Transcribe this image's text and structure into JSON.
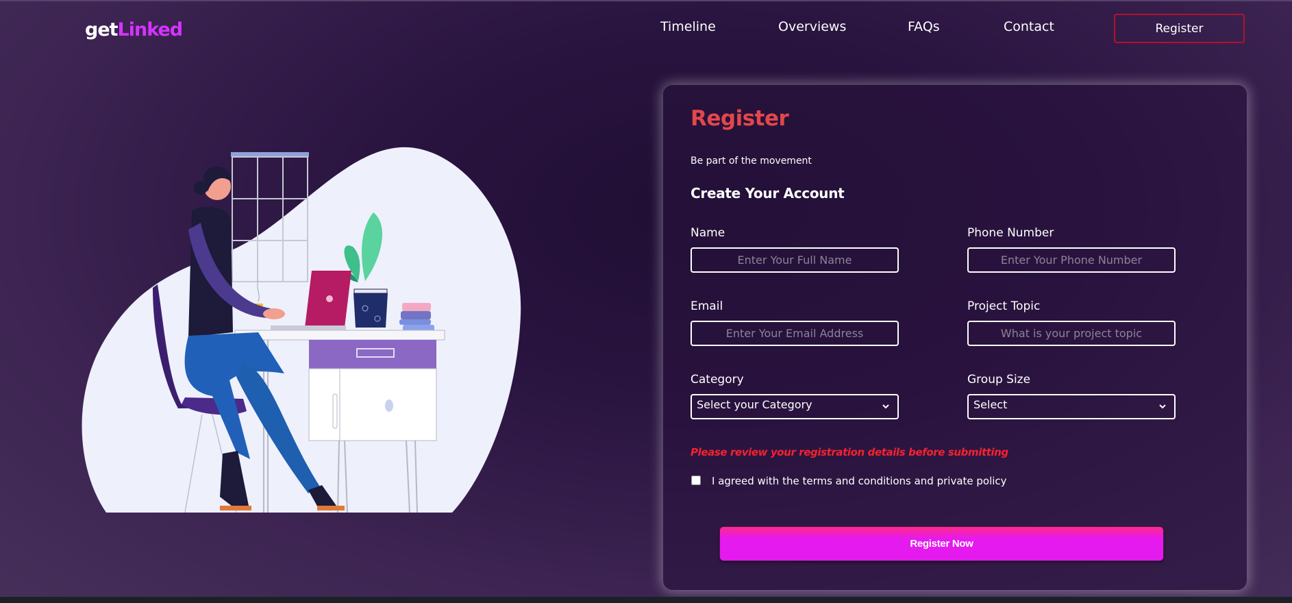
{
  "header": {
    "logo_part1": "get",
    "logo_part2": "Linked",
    "nav": [
      {
        "label": "Timeline"
      },
      {
        "label": "Overviews"
      },
      {
        "label": "FAQs"
      },
      {
        "label": "Contact"
      }
    ],
    "register_button": "Register"
  },
  "form": {
    "title": "Register",
    "subtitle": "Be part of the movement",
    "heading": "Create Your Account",
    "name": {
      "label": "Name",
      "placeholder": "Enter Your Full Name",
      "value": ""
    },
    "phone": {
      "label": "Phone Number",
      "placeholder": "Enter Your Phone Number",
      "value": ""
    },
    "email": {
      "label": "Email",
      "placeholder": "Enter Your Email Address",
      "value": ""
    },
    "topic": {
      "label": "Project Topic",
      "placeholder": "What is your project topic",
      "value": ""
    },
    "category": {
      "label": "Category",
      "selected": "Select your Category"
    },
    "group_size": {
      "label": "Group Size",
      "selected": "Select"
    },
    "warning": "Please review your registration details before submitting",
    "terms": "I agreed with the terms and conditions and private policy",
    "terms_checked": false,
    "submit": "Register Now"
  },
  "colors": {
    "accent": "#d434fe",
    "title_red": "#e2474b",
    "warning_red": "#f5222d",
    "button_pink": "#e51aee"
  },
  "icons": [
    "chevron-down-icon"
  ]
}
